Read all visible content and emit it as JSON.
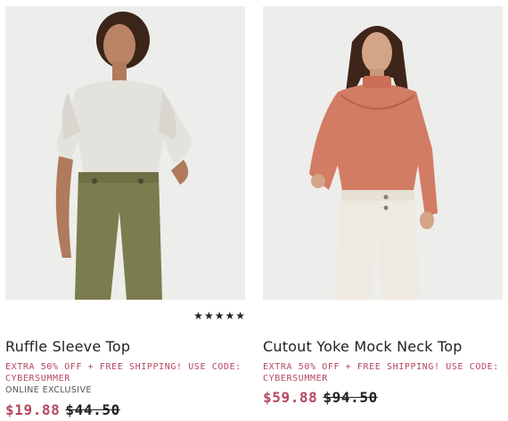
{
  "colors": {
    "sale_price": "#b5485f",
    "promo_text": "#b5485f",
    "background": "#ffffff"
  },
  "products": [
    {
      "name": "Ruffle Sleeve Top",
      "promo": "EXTRA 50% OFF + FREE SHIPPING! USE CODE: CYBERSUMMER",
      "badge": "ONLINE EXCLUSIVE",
      "sale_price": "$19.88",
      "original_price": "$44.50",
      "rating_stars": 5,
      "rating_icon": "star-icon",
      "image_icon": "model-photo-white-ruffle-top"
    },
    {
      "name": "Cutout Yoke Mock Neck Top",
      "promo": "EXTRA 50% OFF + FREE SHIPPING! USE CODE: CYBERSUMMER",
      "sale_price": "$59.88",
      "original_price": "$94.50",
      "image_icon": "model-photo-coral-mock-neck-top"
    }
  ]
}
